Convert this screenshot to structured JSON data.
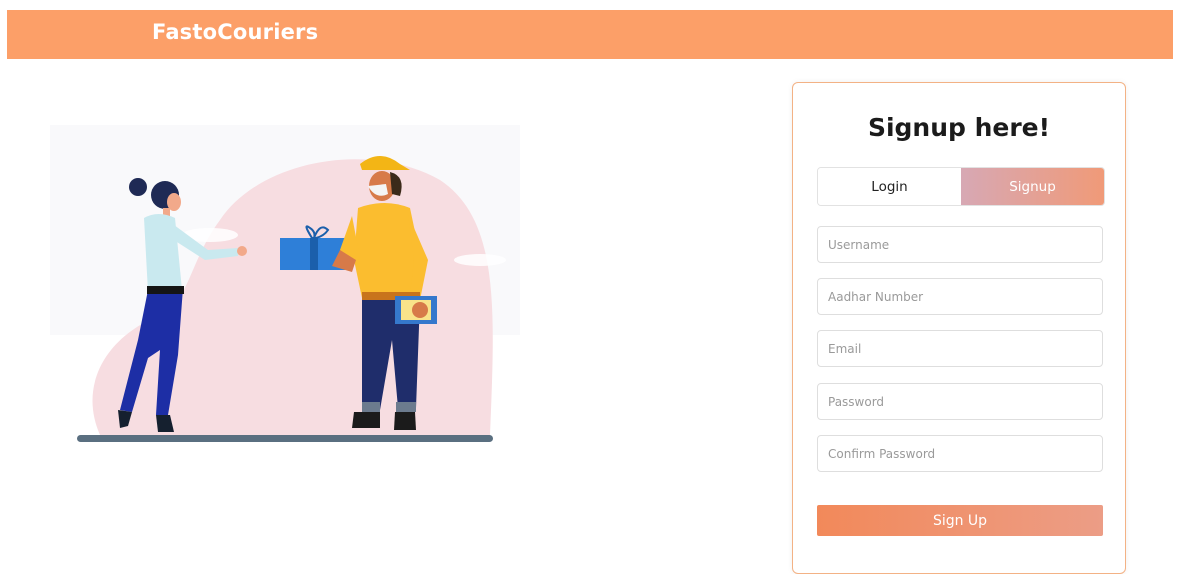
{
  "header": {
    "brand": "FastoCouriers"
  },
  "signup_card": {
    "title": "Signup here!",
    "tabs": [
      {
        "label": "Login",
        "active": false
      },
      {
        "label": "Signup",
        "active": true
      }
    ],
    "fields": [
      {
        "placeholder": "Username",
        "value": ""
      },
      {
        "placeholder": "Aadhar Number",
        "value": ""
      },
      {
        "placeholder": "Email",
        "value": ""
      },
      {
        "placeholder": "Password",
        "value": ""
      },
      {
        "placeholder": "Confirm Password",
        "value": ""
      }
    ],
    "submit_label": "Sign Up"
  },
  "colors": {
    "header_bg": "#fc9f68",
    "accent_gradient_start": "#f2895a",
    "accent_gradient_end": "#ec9d86"
  }
}
